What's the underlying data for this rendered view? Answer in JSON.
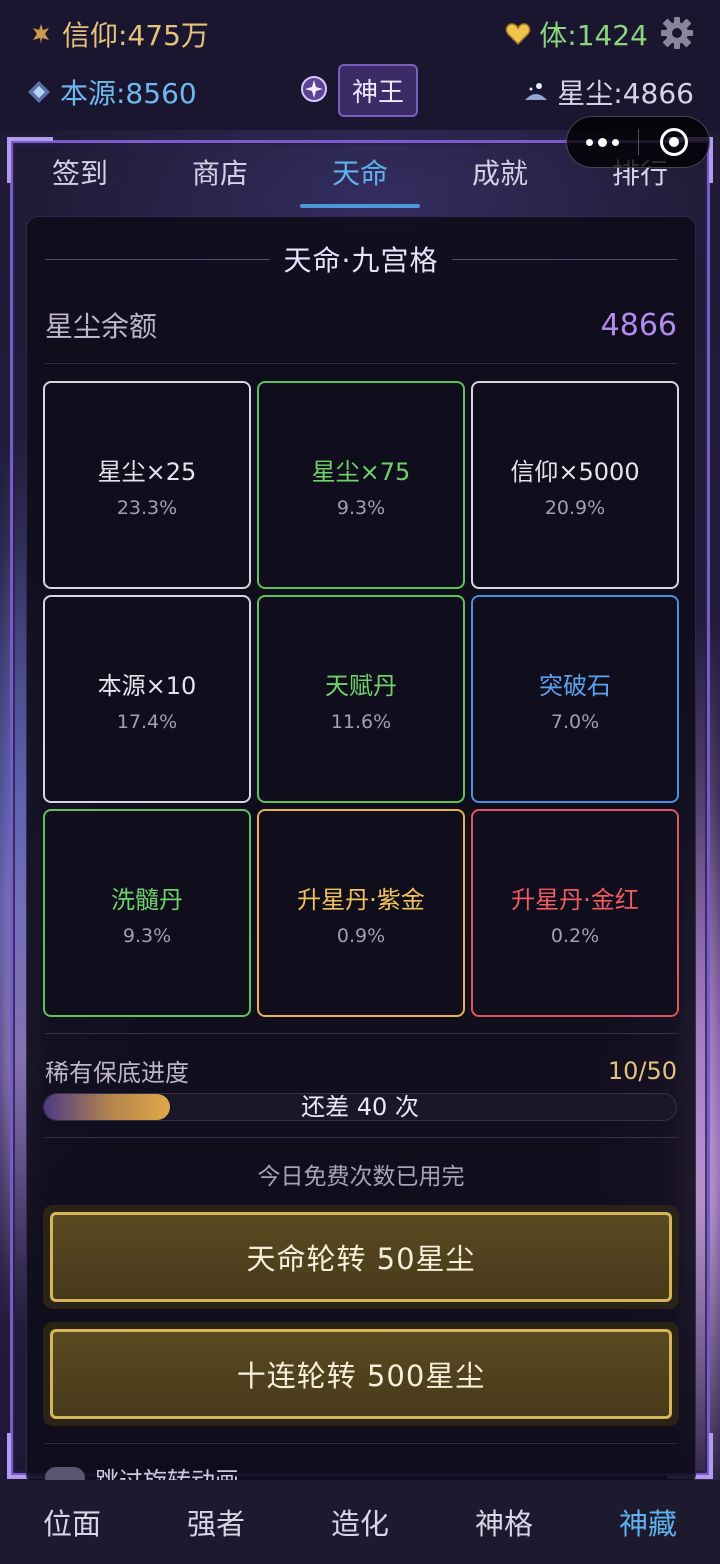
{
  "status": {
    "faith": "信仰:475万",
    "stamina": "体:1424",
    "origin": "本源:8560",
    "rank": "神王",
    "stardust": "星尘:4866"
  },
  "tabs": [
    {
      "label": "签到",
      "active": false
    },
    {
      "label": "商店",
      "active": false
    },
    {
      "label": "天命",
      "active": true
    },
    {
      "label": "成就",
      "active": false
    },
    {
      "label": "排行",
      "active": false
    }
  ],
  "panel": {
    "title": "天命·九宫格",
    "balance_label": "星尘余额",
    "balance_value": "4866",
    "grid": [
      {
        "name": "星尘×25",
        "pct": "23.3%",
        "color": "#d9d6e0",
        "text_color": "#e6e2ee"
      },
      {
        "name": "星尘×75",
        "pct": "9.3%",
        "color": "#5fc25a",
        "text_color": "#6fd16a"
      },
      {
        "name": "信仰×5000",
        "pct": "20.9%",
        "color": "#d9d6e0",
        "text_color": "#e6e2ee"
      },
      {
        "name": "本源×10",
        "pct": "17.4%",
        "color": "#d9d6e0",
        "text_color": "#e6e2ee"
      },
      {
        "name": "天赋丹",
        "pct": "11.6%",
        "color": "#5fc25a",
        "text_color": "#6fd16a"
      },
      {
        "name": "突破石",
        "pct": "7.0%",
        "color": "#4f8fe0",
        "text_color": "#5aa1f0"
      },
      {
        "name": "洗髓丹",
        "pct": "9.3%",
        "color": "#5fc25a",
        "text_color": "#6fd16a"
      },
      {
        "name": "升星丹·紫金",
        "pct": "0.9%",
        "color": "#e6b548",
        "text_color": "#f0c25a"
      },
      {
        "name": "升星丹·金红",
        "pct": "0.2%",
        "color": "#e0555d",
        "text_color": "#ef5c64"
      }
    ],
    "pity_label": "稀有保底进度",
    "pity_value": "10/50",
    "pity_progress": 0.2,
    "pity_remaining": "还差 40 次",
    "free_note": "今日免费次数已用完",
    "single_button": "天命轮转 50星尘",
    "ten_button": "十连轮转 500星尘",
    "skip_label": "跳过旋转动画"
  },
  "bottom_nav": [
    {
      "label": "位面",
      "active": false
    },
    {
      "label": "强者",
      "active": false
    },
    {
      "label": "造化",
      "active": false
    },
    {
      "label": "神格",
      "active": false
    },
    {
      "label": "神藏",
      "active": true
    }
  ]
}
